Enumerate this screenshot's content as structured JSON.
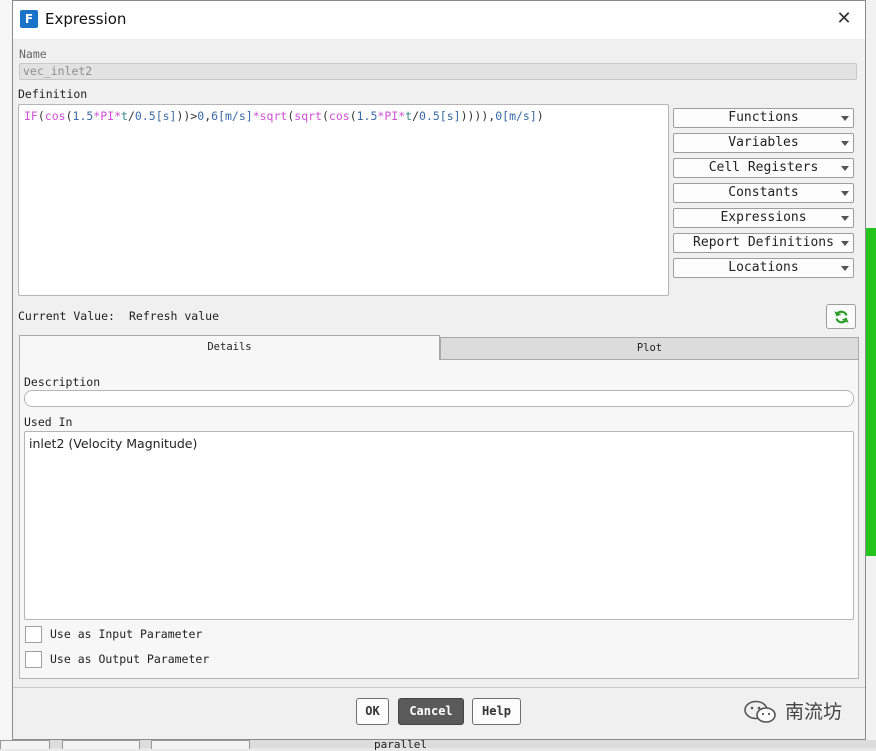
{
  "window": {
    "title": "Expression",
    "app_icon_letter": "F"
  },
  "name_field": {
    "label": "Name",
    "value": "vec_inlet2"
  },
  "definition": {
    "label": "Definition",
    "tokens": [
      {
        "t": "IF",
        "c": "k"
      },
      {
        "t": "(",
        "c": "p"
      },
      {
        "t": "cos",
        "c": "k"
      },
      {
        "t": "(",
        "c": "p"
      },
      {
        "t": "1.5",
        "c": "n"
      },
      {
        "t": "*",
        "c": "k"
      },
      {
        "t": "PI",
        "c": "k"
      },
      {
        "t": "*",
        "c": "k"
      },
      {
        "t": "t",
        "c": "v"
      },
      {
        "t": "/",
        "c": "p"
      },
      {
        "t": "0.5",
        "c": "n"
      },
      {
        "t": "[s]",
        "c": "u"
      },
      {
        "t": "))>",
        "c": "p"
      },
      {
        "t": "0",
        "c": "n"
      },
      {
        "t": ",",
        "c": "p"
      },
      {
        "t": "6",
        "c": "n"
      },
      {
        "t": "[m/s]",
        "c": "u"
      },
      {
        "t": "*",
        "c": "k"
      },
      {
        "t": "sqrt",
        "c": "k"
      },
      {
        "t": "(",
        "c": "p"
      },
      {
        "t": "sqrt",
        "c": "k"
      },
      {
        "t": "(",
        "c": "p"
      },
      {
        "t": "cos",
        "c": "k"
      },
      {
        "t": "(",
        "c": "p"
      },
      {
        "t": "1.5",
        "c": "n"
      },
      {
        "t": "*",
        "c": "k"
      },
      {
        "t": "PI",
        "c": "k"
      },
      {
        "t": "*",
        "c": "k"
      },
      {
        "t": "t",
        "c": "v"
      },
      {
        "t": "/",
        "c": "p"
      },
      {
        "t": "0.5",
        "c": "n"
      },
      {
        "t": "[s]",
        "c": "u"
      },
      {
        "t": ")))),",
        "c": "p"
      },
      {
        "t": "0",
        "c": "n"
      },
      {
        "t": "[m/s]",
        "c": "u"
      },
      {
        "t": ")",
        "c": "p"
      }
    ]
  },
  "side_buttons": [
    "Functions",
    "Variables",
    "Cell Registers",
    "Constants",
    "Expressions",
    "Report Definitions",
    "Locations"
  ],
  "current_value": {
    "label": "Current Value:",
    "value": "Refresh value"
  },
  "tabs": [
    {
      "label": "Details",
      "active": true
    },
    {
      "label": "Plot",
      "active": false
    }
  ],
  "details": {
    "description_label": "Description",
    "description_value": "",
    "used_in_label": "Used In",
    "used_in_items": [
      "inlet2 (Velocity Magnitude)"
    ],
    "input_param_label": "Use as Input Parameter",
    "output_param_label": "Use as Output Parameter"
  },
  "buttons": {
    "ok": "OK",
    "cancel": "Cancel",
    "help": "Help"
  },
  "watermark": "南流坊",
  "background": {
    "bottom_text": "parallel"
  },
  "colors": {
    "keyword": "#d050d6",
    "variable": "#3a8a8a",
    "number": "#3a6aa6",
    "green_bar": "#23c41c",
    "app_icon": "#1a73c8"
  },
  "icons": {
    "refresh": "refresh-icon",
    "close": "close-icon",
    "dropdown": "chevron-down-icon"
  }
}
